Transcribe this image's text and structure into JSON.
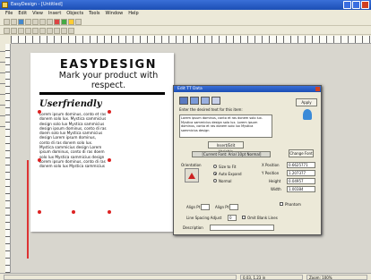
{
  "window": {
    "title": "EasyDesign - [Untitled]"
  },
  "menu": [
    "File",
    "Edit",
    "View",
    "Insert",
    "Objects",
    "Tools",
    "Window",
    "Help"
  ],
  "document": {
    "heading": "EASYDESIGN",
    "subheading": "Mark your product with respect.",
    "section_title": "Userfriendly",
    "body_text": "Lorem ipsum dominus, conto et ras donem solo lux. Mystica sammicius design solo lux Mystica sammicius design ipsum dominus, conto di ras doem solo lux Mystica sammicius design Lorem ipsum dominus, conto di ras donem solo lux. Mystica sammicius design Lorem ipsum dominus, conto di ras doem solo lux Mystica sammicius design Lorem ipsum dominus, conto di ras donem solo lux Mystica sammicius"
  },
  "dialog": {
    "title": "Edit TT Data",
    "prompt": "Enter the desired text for this item:",
    "text_value": "Lorem ipsum dominus, conto et ras donem solo lux. Mystica sammicius design solo lux. Lorem ipsum dominus, conto et ras donem solo lux Mystica sammicius design",
    "apply_label": "Apply",
    "insert_variable_label": "Insert/Edit Variable",
    "font_display": "[Current Font: Arial 10pt Normal]",
    "change_font_label": "Change Font",
    "alignment_label": "Orientation",
    "fit_options": [
      "Size to Fit",
      "Auto Expand",
      "Normal"
    ],
    "fit_selected": 1,
    "position_labels": [
      "X Position",
      "Y Position",
      "Height",
      "Width"
    ],
    "position_values": [
      "0.6625771",
      "1.207377",
      "0.04957",
      "1.00384"
    ],
    "phantom_label": "Phantom",
    "align_x_label": "Align Pt",
    "align_y_label": "Align Pt",
    "line_spacing_label": "Line Spacing Adjust",
    "line_spacing_value": "0",
    "omit_blank_label": "Omit Blank Lines",
    "description_label": "Description"
  },
  "status": {
    "left": "",
    "pos": "0.03, 1.23 in",
    "zoom": "Zoom: 100%"
  }
}
